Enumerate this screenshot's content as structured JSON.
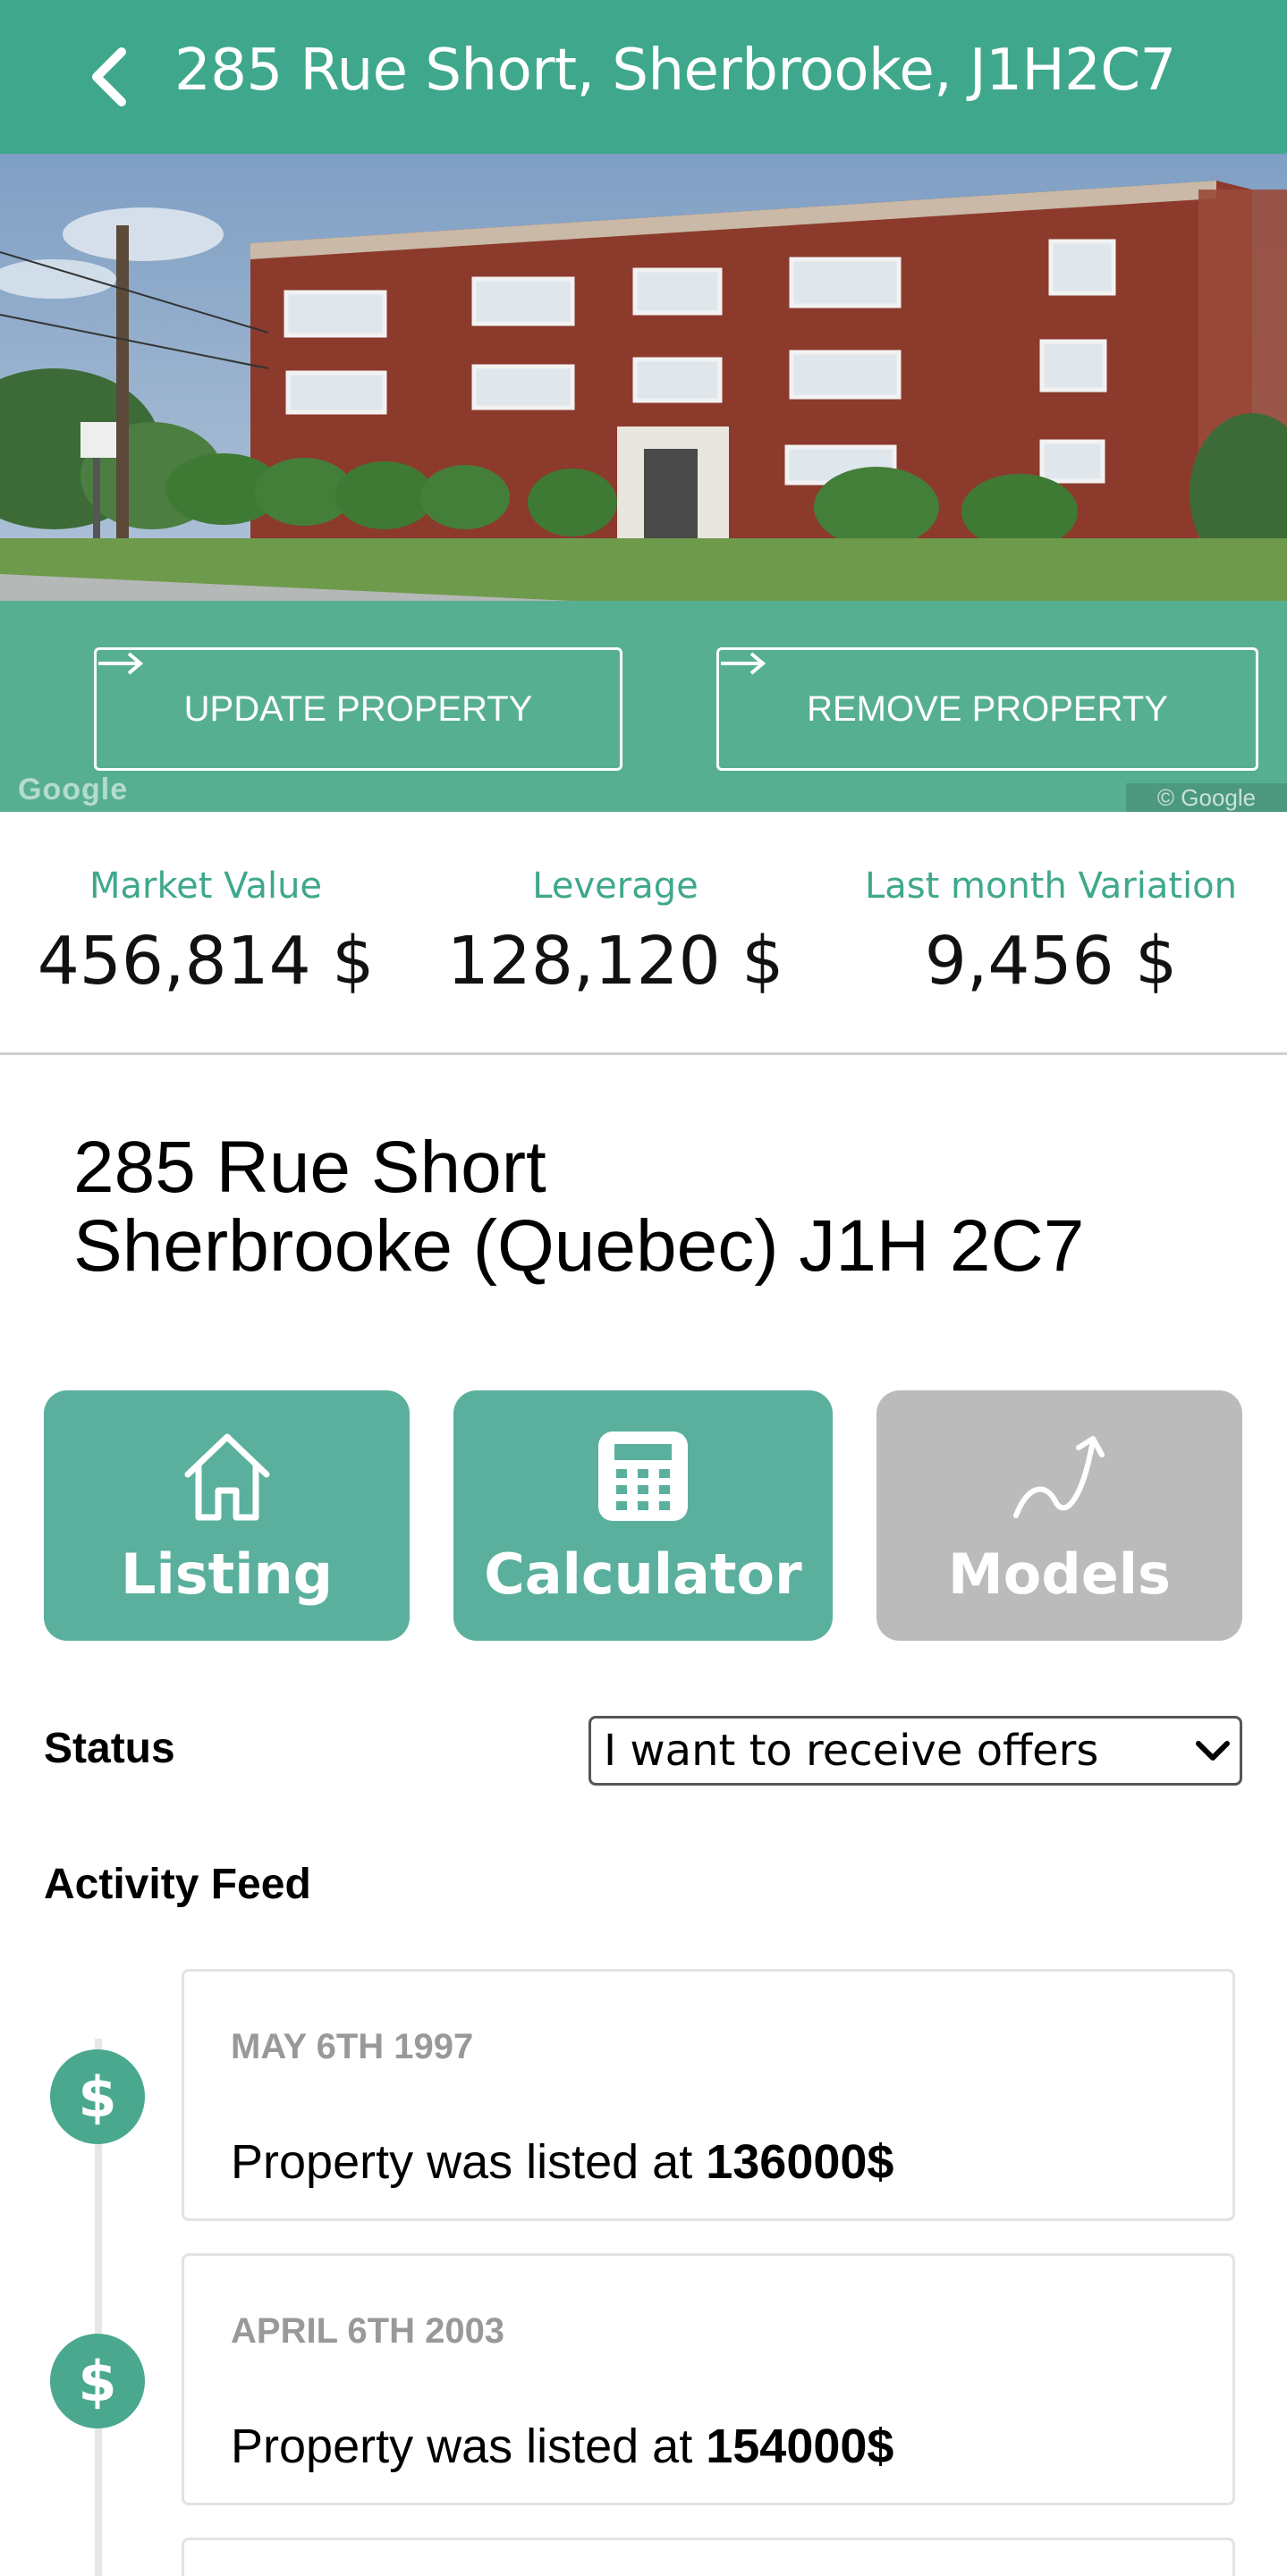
{
  "header": {
    "title": "285 Rue Short, Sherbrooke, J1H2C7",
    "back_icon": "chevron-left-icon"
  },
  "hero": {
    "update_button": "UPDATE PROPERTY",
    "remove_button": "REMOVE PROPERTY",
    "button_icon": "arrow-right-icon",
    "map_logo": "Google",
    "map_copyright": "© Google"
  },
  "stats": [
    {
      "label": "Market Value",
      "value": "456,814 $"
    },
    {
      "label": "Leverage",
      "value": "128,120 $"
    },
    {
      "label": "Last month Variation",
      "value": "9,456 $"
    }
  ],
  "address": {
    "line1": "285 Rue Short",
    "line2": "Sherbrooke (Quebec) J1H 2C7"
  },
  "tiles": [
    {
      "label": "Listing",
      "icon": "house-icon",
      "enabled": true
    },
    {
      "label": "Calculator",
      "icon": "calculator-icon",
      "enabled": true
    },
    {
      "label": "Models",
      "icon": "trend-curve-icon",
      "enabled": false
    }
  ],
  "status": {
    "label": "Status",
    "selected": "I want to receive offers"
  },
  "feed": {
    "title": "Activity Feed",
    "items": [
      {
        "date": "MAY 6TH 1997",
        "text": "Property was listed at ",
        "amount": "136000$",
        "icon": "dollar-icon"
      },
      {
        "date": "APRIL 6TH 2003",
        "text": "Property was listed at ",
        "amount": "154000$",
        "icon": "dollar-icon"
      }
    ]
  },
  "colors": {
    "accent": "#3fa88c",
    "tile_active": "#5ab09d",
    "tile_disabled": "#bbbbbb"
  }
}
